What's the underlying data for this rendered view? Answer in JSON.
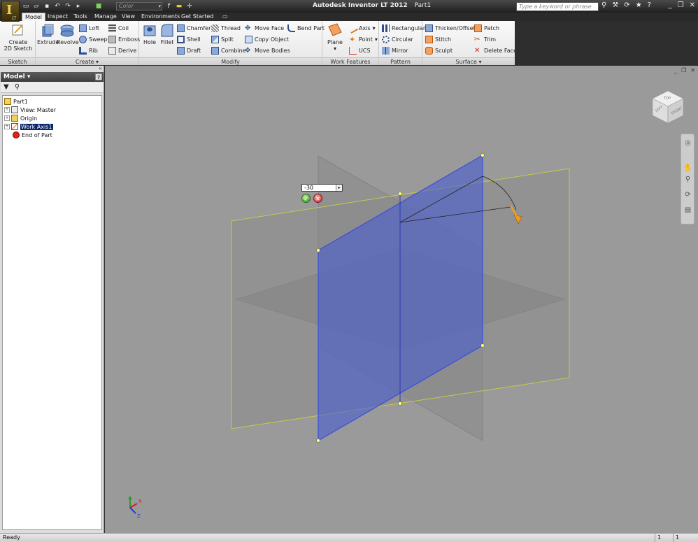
{
  "window": {
    "app_title": "Autodesk Inventor LT 2012",
    "doc_title": "Part1",
    "logo_letter": "I",
    "logo_sub": "LT"
  },
  "qat": {
    "color_combo": "Color",
    "icons": [
      "new-icon",
      "open-icon",
      "save-icon",
      "undo-icon",
      "redo-icon",
      "select-icon",
      "update-icon",
      "fx-icon",
      "measure-icon"
    ]
  },
  "search": {
    "placeholder": "Type a keyword or phrase"
  },
  "tabs": [
    "Model",
    "Inspect",
    "Tools",
    "Manage",
    "View",
    "Environments",
    "Get Started"
  ],
  "ribbon": {
    "sketch": {
      "title": "Sketch",
      "create_sketch_line1": "Create",
      "create_sketch_line2": "2D Sketch"
    },
    "create": {
      "title": "Create",
      "extrude": "Extrude",
      "revolve": "Revolve",
      "loft": "Loft",
      "sweep": "Sweep",
      "rib": "Rib",
      "coil": "Coil",
      "emboss": "Emboss",
      "derive": "Derive"
    },
    "modify": {
      "title": "Modify",
      "hole": "Hole",
      "fillet": "Fillet",
      "chamfer": "Chamfer",
      "shell": "Shell",
      "draft": "Draft",
      "thread": "Thread",
      "split": "Split",
      "combine": "Combine",
      "move_face": "Move Face",
      "copy_object": "Copy Object",
      "move_bodies": "Move Bodies",
      "bend_part": "Bend Part"
    },
    "work_features": {
      "title": "Work Features",
      "plane": "Plane",
      "axis": "Axis",
      "point": "Point",
      "ucs": "UCS"
    },
    "pattern": {
      "title": "Pattern",
      "rectangular": "Rectangular",
      "circular": "Circular",
      "mirror": "Mirror"
    },
    "surface": {
      "title": "Surface",
      "thicken_offset": "Thicken/Offset",
      "stitch": "Stitch",
      "sculpt": "Sculpt",
      "patch": "Patch",
      "trim": "Trim",
      "delete_face": "Delete Face"
    }
  },
  "browser": {
    "title": "Model",
    "help": "?",
    "tree": [
      {
        "label": "Part1",
        "expander": "",
        "indent": 0,
        "selected": false
      },
      {
        "label": "View: Master",
        "expander": "+",
        "indent": 1,
        "selected": false
      },
      {
        "label": "Origin",
        "expander": "+",
        "indent": 1,
        "selected": false
      },
      {
        "label": "Work Axis1",
        "expander": "+",
        "indent": 1,
        "selected": true
      },
      {
        "label": "End of Part",
        "expander": "",
        "indent": 1,
        "selected": false
      }
    ]
  },
  "viewport": {
    "angle_value": "-30",
    "viewcube_top": "TOP",
    "viewcube_left": "LEFT",
    "viewcube_front": "FRONT",
    "triad_x": "X",
    "triad_z": "Z"
  },
  "status": {
    "text": "Ready",
    "field1": "1",
    "field2": "1"
  },
  "colors": {
    "work_plane_selected": "#4c5fd0",
    "work_plane_grey": "#808080",
    "plane_edge_yellow": "#c8c84a",
    "viewport_bg": "#9a9a9a"
  }
}
